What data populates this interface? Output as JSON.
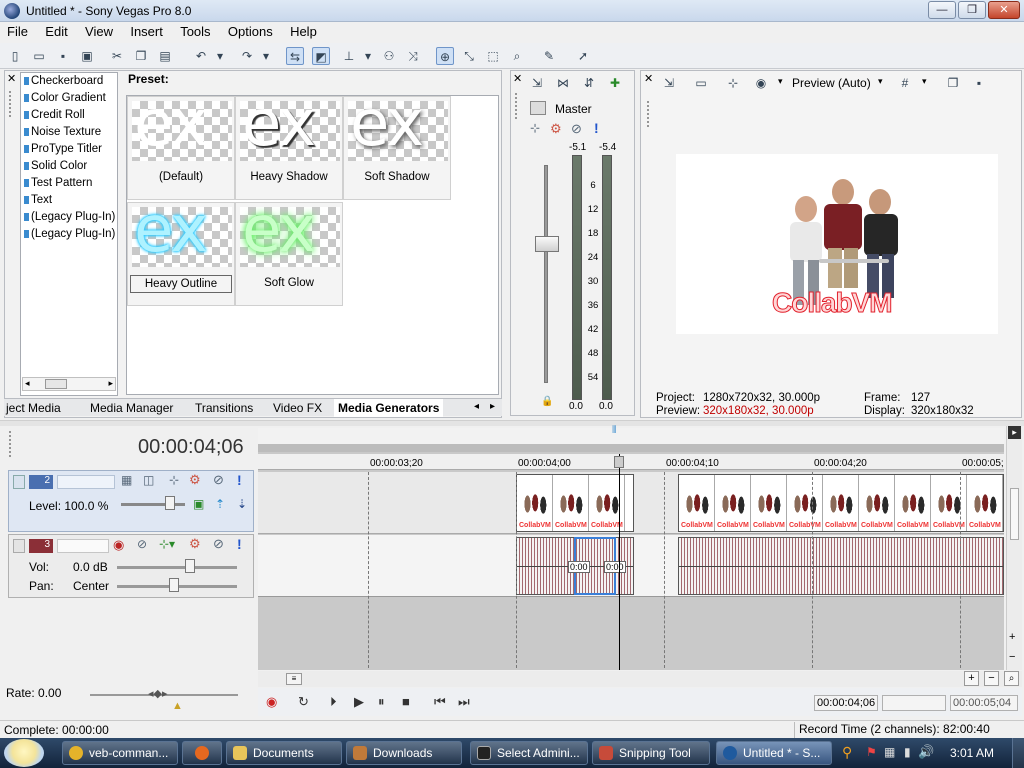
{
  "window": {
    "title": "Untitled * - Sony Vegas Pro 8.0",
    "minimize": "—",
    "maximize": "❐",
    "close": "✕"
  },
  "menu": [
    "File",
    "Edit",
    "View",
    "Insert",
    "Tools",
    "Options",
    "Help"
  ],
  "generators": {
    "list": [
      "Checkerboard",
      "Color Gradient",
      "Credit Roll",
      "Noise Texture",
      "ProType Titler",
      "Solid Color",
      "Test Pattern",
      "Text",
      "(Legacy Plug-In) T",
      "(Legacy Plug-In) V"
    ],
    "preset_label": "Preset:",
    "presets": [
      {
        "name": "(Default)",
        "color": "#ffffff"
      },
      {
        "name": "Heavy Shadow",
        "color": "#ffffff"
      },
      {
        "name": "Soft Shadow",
        "color": "#ffffff"
      },
      {
        "name": "Heavy Outline",
        "color": "#aef2ff"
      },
      {
        "name": "Soft Glow",
        "color": "#c8ffc8"
      }
    ],
    "thumb_text": "ex"
  },
  "window_tabs": [
    "ject Media",
    "Media Manager",
    "Transitions",
    "Video FX",
    "Media Generators"
  ],
  "mixer": {
    "label": "Master",
    "peak_left": "-5.1",
    "peak_right": "-5.4",
    "scale": [
      "6",
      "12",
      "18",
      "24",
      "30",
      "36",
      "42",
      "48",
      "54"
    ],
    "value_left": "0.0",
    "value_right": "0.0"
  },
  "preview": {
    "mode": "Preview (Auto)",
    "watermark": "CollabVM",
    "project_label": "Project:",
    "project_value": "1280x720x32, 30.000p",
    "preview_label": "Preview:",
    "preview_value": "320x180x32, 30.000p",
    "frame_label": "Frame:",
    "frame_value": "127",
    "display_label": "Display:",
    "display_value": "320x180x32"
  },
  "timeline": {
    "timecode": "00:00:04;06",
    "ruler": [
      "00:00:03;20",
      "00:00:04;00",
      "00:00:04;10",
      "00:00:04;20",
      "00:00:05;"
    ],
    "video_track": {
      "number": "2",
      "level": "Level: 100.0 %"
    },
    "audio_track": {
      "number": "3",
      "vol_label": "Vol:",
      "vol_value": "0.0 dB",
      "pan_label": "Pan:",
      "pan_value": "Center"
    },
    "fade_a": "0:00",
    "fade_b": "0:00"
  },
  "transport": {
    "rate": "Rate: 0.00",
    "cursor_time": "00:00:04;06",
    "end_time": "00:00:05;04"
  },
  "status": {
    "complete": "Complete: 00:00:00",
    "record_time": "Record Time (2 channels): 82:00:40"
  },
  "taskbar": {
    "items": [
      {
        "label": "veb-comman...",
        "color": "#e5b32a"
      },
      {
        "label": "",
        "color": "#e5681f"
      },
      {
        "label": "Documents",
        "color": "#e8c55a"
      },
      {
        "label": "Downloads",
        "color": "#c07a3a"
      },
      {
        "label": "Select Admini...",
        "color": "#222222"
      },
      {
        "label": "Snipping Tool",
        "color": "#c74b3a"
      },
      {
        "label": "Untitled * - S...",
        "color": "#1f5a9e"
      }
    ],
    "clock": "3:01 AM"
  }
}
